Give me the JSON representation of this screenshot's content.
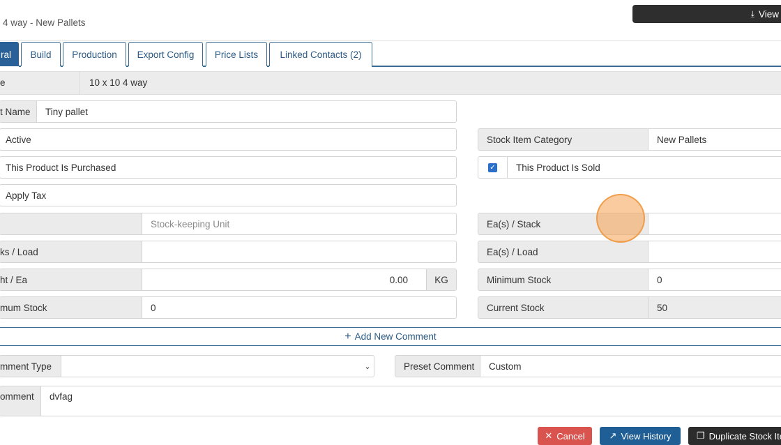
{
  "header": {
    "title": "4 way - New Pallets",
    "view_button_label": "View",
    "view_icon": "download-icon"
  },
  "tabs": [
    {
      "label": "ral",
      "active": true
    },
    {
      "label": "Build"
    },
    {
      "label": "Production"
    },
    {
      "label": "Export Config"
    },
    {
      "label": "Price Lists"
    },
    {
      "label": "Linked Contacts (2)"
    }
  ],
  "name_strip": {
    "label": "e",
    "value": "10 x 10 4 way"
  },
  "left": {
    "product_name": {
      "label": "t Name",
      "value": "Tiny pallet"
    },
    "active": "Active",
    "purchased": "This Product Is Purchased",
    "apply_tax": "Apply Tax",
    "sku": {
      "placeholder": "Stock-keeping Unit"
    },
    "packs_load": {
      "label": "ks / Load",
      "value": ""
    },
    "weight": {
      "label": "ht / Ea",
      "value": "0.00",
      "unit": "KG"
    },
    "max_stock": {
      "label": "mum Stock",
      "value": "0"
    }
  },
  "right": {
    "category": {
      "label": "Stock Item Category",
      "value": "New Pallets"
    },
    "sold": {
      "label": "This Product Is Sold",
      "checked": true
    },
    "ea_stack": {
      "label": "Ea(s) / Stack",
      "value": ""
    },
    "ea_load": {
      "label": "Ea(s) / Load",
      "value": ""
    },
    "min_stock": {
      "label": "Minimum Stock",
      "value": "0"
    },
    "current_stock": {
      "label": "Current Stock",
      "value": "50"
    }
  },
  "comments": {
    "add_label": "Add New Comment",
    "type_label": "mment Type",
    "type_value": "",
    "preset_label": "Preset Comment",
    "preset_value": "Custom",
    "comment_label": "omment",
    "comment_value": "dvfag"
  },
  "buttons": {
    "cancel": "Cancel",
    "history": "View History",
    "duplicate": "Duplicate Stock Ite"
  },
  "colors": {
    "primary": "#2a6098",
    "danger": "#d9534f",
    "dark": "#2c2c2c"
  }
}
